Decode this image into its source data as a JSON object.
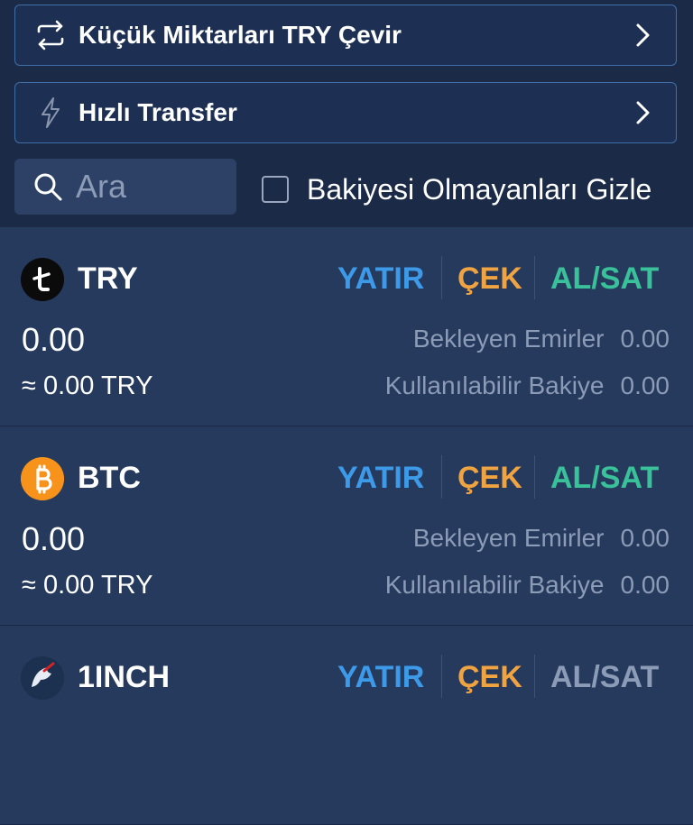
{
  "actions": {
    "convert_small": {
      "label": "Küçük Miktarları TRY Çevir",
      "icon": "swap-arrows-icon"
    },
    "fast_transfer": {
      "label": "Hızlı Transfer",
      "icon": "lightning-icon"
    }
  },
  "search": {
    "placeholder": "Ara"
  },
  "filter": {
    "hide_zero_label": "Bakiyesi Olmayanları Gizle",
    "checked": false
  },
  "colors": {
    "deposit": "#3d9ae8",
    "withdraw": "#f0a341",
    "trade": "#39c19a",
    "trade_disabled": "#8c9bb6"
  },
  "coins": [
    {
      "symbol": "TRY",
      "deposit_label": "YATIR",
      "withdraw_label": "ÇEK",
      "trade_label": "AL/SAT",
      "balance": "0.00",
      "approx": "≈ 0.00 TRY",
      "pending_label": "Bekleyen Emirler",
      "pending_value": "0.00",
      "available_label": "Kullanılabilir Bakiye",
      "available_value": "0.00"
    },
    {
      "symbol": "BTC",
      "deposit_label": "YATIR",
      "withdraw_label": "ÇEK",
      "trade_label": "AL/SAT",
      "balance": "0.00",
      "approx": "≈ 0.00 TRY",
      "pending_label": "Bekleyen Emirler",
      "pending_value": "0.00",
      "available_label": "Kullanılabilir Bakiye",
      "available_value": "0.00"
    },
    {
      "symbol": "1INCH",
      "deposit_label": "YATIR",
      "withdraw_label": "ÇEK",
      "trade_label": "AL/SAT"
    }
  ]
}
